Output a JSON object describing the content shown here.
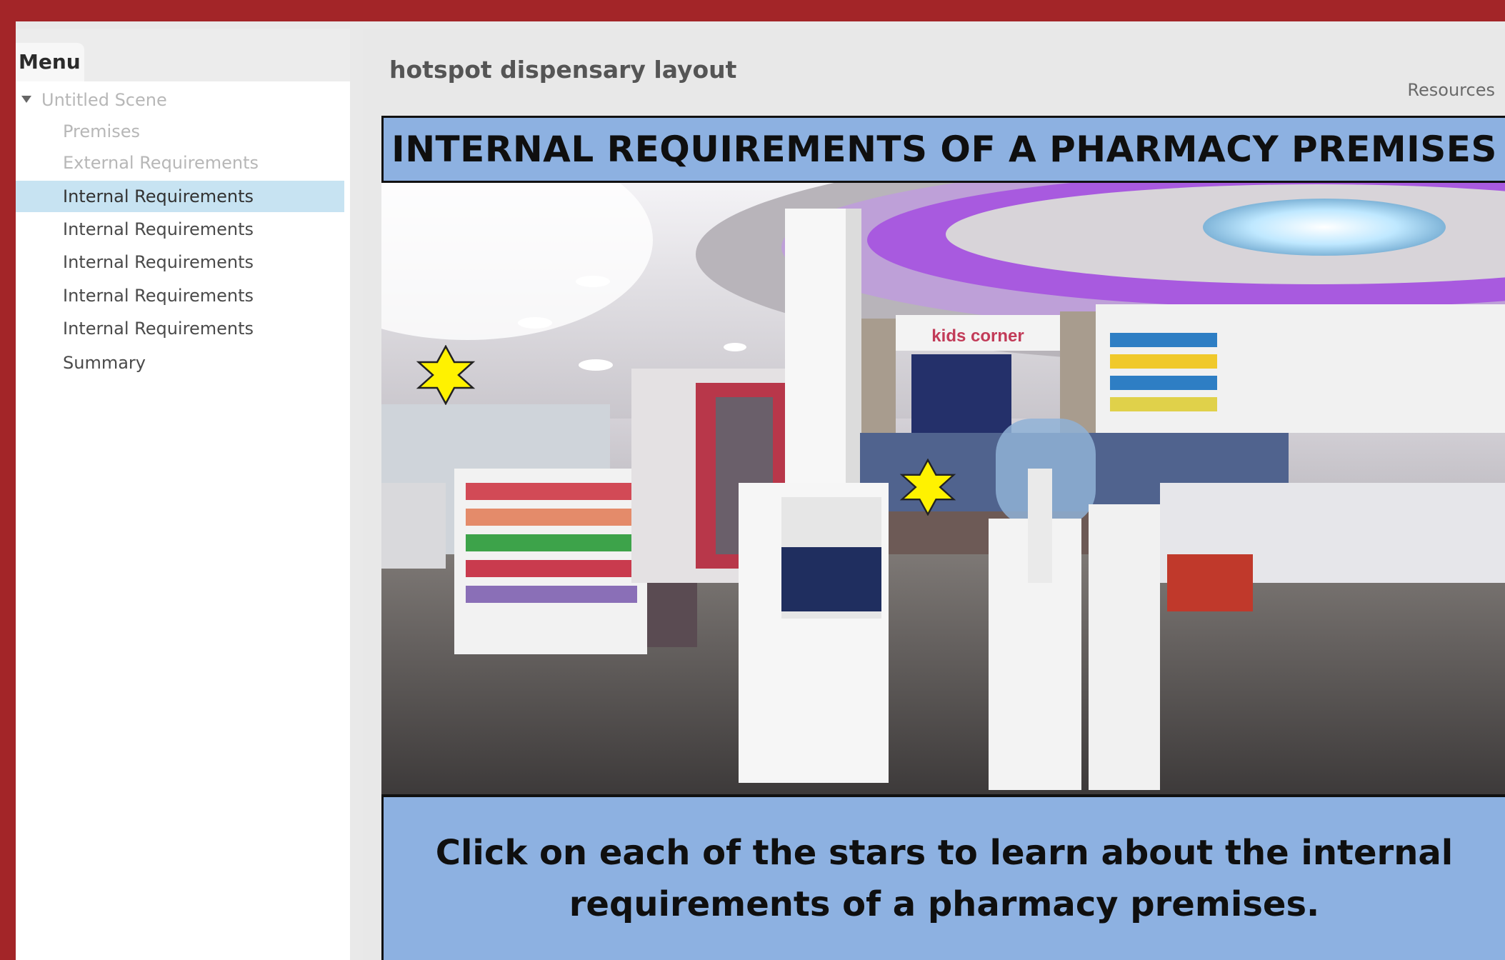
{
  "sidebar": {
    "menu_label": "Menu",
    "scene_label": "Untitled Scene",
    "items": [
      {
        "label": "Premises",
        "state": "disabled"
      },
      {
        "label": "External Requirements",
        "state": "disabled"
      },
      {
        "label": "Internal Requirements",
        "state": "active"
      },
      {
        "label": "Internal Requirements",
        "state": "normal"
      },
      {
        "label": "Internal Requirements",
        "state": "normal"
      },
      {
        "label": "Internal Requirements",
        "state": "normal"
      },
      {
        "label": "Internal Requirements",
        "state": "normal"
      },
      {
        "label": "Summary",
        "state": "normal"
      }
    ]
  },
  "main": {
    "title": "hotspot dispensary layout",
    "resources_label": "Resources"
  },
  "slide": {
    "heading": "INTERNAL REQUIREMENTS OF A PHARMACY PREMISES",
    "instruction": "Click on each of the stars to learn about the internal requirements of a pharmacy premises.",
    "photo_signs": {
      "kids_corner": "kids corner"
    },
    "hotspots": [
      {
        "icon": "star-icon"
      },
      {
        "icon": "star-icon"
      }
    ]
  },
  "colors": {
    "frame": "#a32528",
    "panel_blue": "#8db1e1",
    "active_item": "#c7e3f2",
    "star": "#fff200"
  }
}
